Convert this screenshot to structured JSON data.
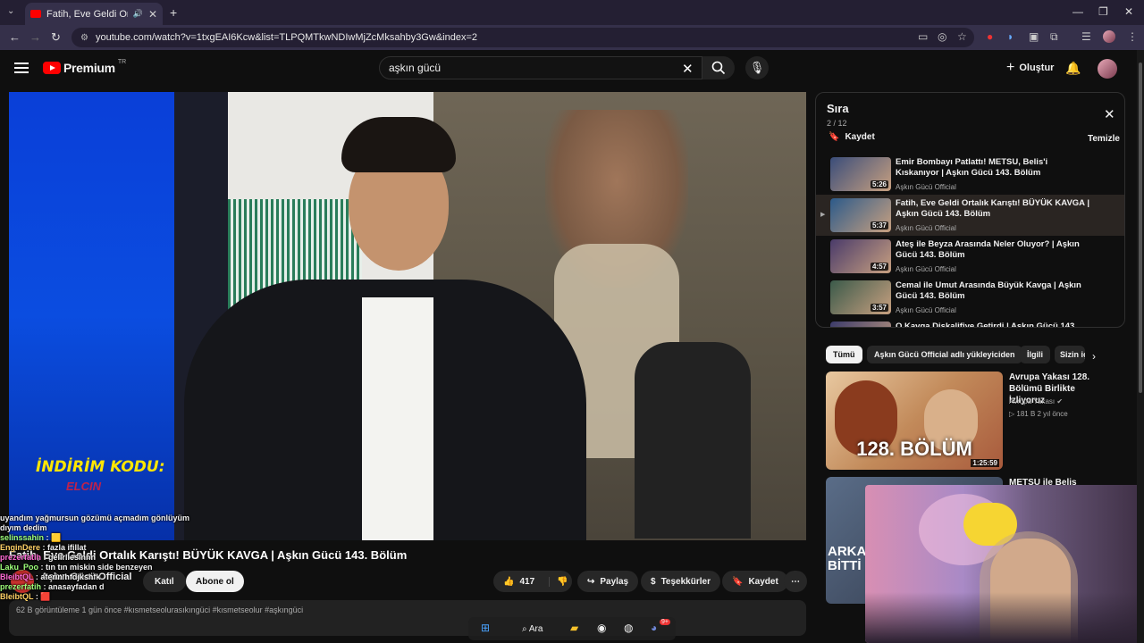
{
  "browser": {
    "tab_title": "Fatih, Eve Geldi Ortalık Karış",
    "url": "youtube.com/watch?v=1txgEAI6Kcw&list=TLPQMTkwNDIwMjZcMksahby3Gw&index=2"
  },
  "header": {
    "logo_text": "Premium",
    "logo_region": "TR",
    "search_query": "aşkın gücü",
    "create_label": "Oluştur"
  },
  "video": {
    "title": "Fatih, Eve Geldi Ortalık Karıştı! BÜYÜK KAVGA | Aşkın Gücü 143. Bölüm",
    "overlay_text_1": "İNDİRİM KODU:",
    "overlay_text_2": "ELCIN",
    "channel_name": "Aşkın Gücü Official",
    "channel_subs": "",
    "join_label": "Katıl",
    "subscribe_label": "Abone ol",
    "like_count": "417",
    "share_label": "Paylaş",
    "thanks_label": "Teşekkürler",
    "save_label": "Kaydet",
    "description_meta": "62 B görüntüleme  1 gün önce  #kısmetseolurasıkıngüci #kısmetseolur #aşkıngüci"
  },
  "chat": {
    "lines": [
      {
        "user": "",
        "text": "uyandım yağmursun gözümü açmadım gönlüyüm"
      },
      {
        "user": "",
        "text": "dıyım dedim"
      },
      {
        "user": "selinssahin",
        "text": ": 🟨"
      },
      {
        "user": "EnginDere",
        "text": ": fazla ifillat"
      },
      {
        "user": "prezerfatih",
        "text": ": gelirllesinnn"
      },
      {
        "user": "",
        "text": ""
      },
      {
        "user": "Laku_Poo",
        "text": ": tın tın miskin side benzeyen"
      },
      {
        "user": "",
        "text": ""
      },
      {
        "user": "BleibtQL",
        "text": ": aferin hfdjkshfk"
      },
      {
        "user": "",
        "text": ""
      },
      {
        "user": "prezerfatih",
        "text": ": anasayfadan d"
      },
      {
        "user": "BleibtQL",
        "text": ": 🟥"
      }
    ]
  },
  "queue": {
    "title": "Sıra",
    "count": "2 / 12",
    "save_label": "Kaydet",
    "clear_label": "Temizle",
    "items": [
      {
        "title": "Emir Bombayı Patlattı! METSU, Belis'i Kıskanıyor | Aşkın Gücü 143. Bölüm",
        "channel": "Aşkın Gücü Official",
        "duration": "5:26"
      },
      {
        "title": "Fatih, Eve Geldi Ortalık Karıştı! BÜYÜK KAVGA | Aşkın Gücü 143. Bölüm",
        "channel": "Aşkın Gücü Official",
        "duration": "5:37"
      },
      {
        "title": "Ateş ile Beyza Arasında Neler Oluyor? | Aşkın Gücü 143. Bölüm",
        "channel": "Aşkın Gücü Official",
        "duration": "4:57"
      },
      {
        "title": "Cemal ile Umut Arasında Büyük Kavga | Aşkın Gücü 143. Bölüm",
        "channel": "Aşkın Gücü Official",
        "duration": "3:57"
      },
      {
        "title": "O Kavga Diskalifiye Getirdi | Aşkın Gücü 143...",
        "channel": "",
        "duration": ""
      }
    ]
  },
  "chips": [
    "Tümü",
    "Aşkın Gücü Official adlı yükleyiciden",
    "İlgili",
    "Sizin için"
  ],
  "recommended": [
    {
      "title": "Avrupa Yakası 128. Bölümü Birlikte İzliyoruz",
      "channel": "Avrupa Yakası",
      "meta": "181 B  2 yıl önce",
      "duration": "1:25:59",
      "thumb_text": "128. BÖLÜM"
    },
    {
      "title": "METSU ile Belis Arasında",
      "channel": "",
      "meta": "",
      "duration": "",
      "thumb_text": "ARKA BİTTİ"
    }
  ],
  "taskbar": {
    "search_label": "Ara",
    "discord_badge": "9+"
  },
  "colors": {
    "bg": "#0f0f0f",
    "accent": "#ff0000",
    "browser_frame": "#35304a"
  }
}
